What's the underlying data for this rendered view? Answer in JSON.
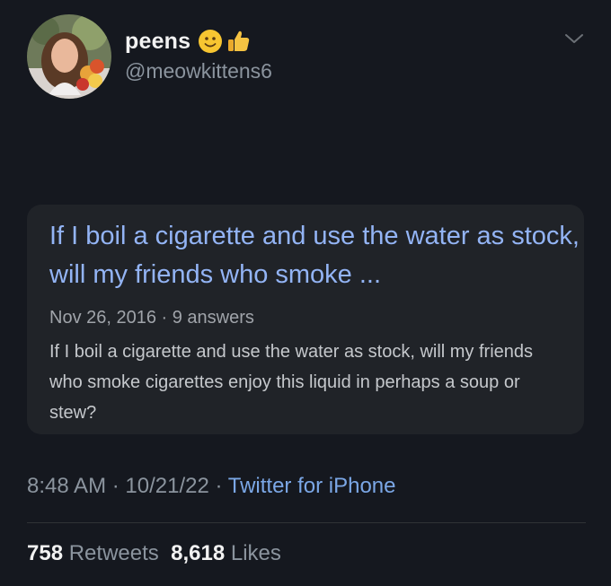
{
  "tweet": {
    "author": {
      "display_name": "peens",
      "handle": "@meowkittens6",
      "name_emojis": [
        "slightly-smiling-face",
        "thumbs-up"
      ]
    },
    "quoted_result": {
      "title": "If I boil a cigarette and use the water as stock, will my friends who smoke ...",
      "meta": "Nov 26, 2016 · 9 answers",
      "snippet": "If I boil a cigarette and use the water as stock, will my friends who smoke cigarettes enjoy this liquid in perhaps a soup or stew?"
    },
    "time": "8:48 AM",
    "date": "10/21/22",
    "separator": "·",
    "source": "Twitter for iPhone",
    "retweets_count": "758",
    "retweets_label": "Retweets",
    "likes_count": "8,618",
    "likes_label": "Likes"
  },
  "colors": {
    "background": "#15181f",
    "card_background": "#202328",
    "link_blue": "#93b4f5",
    "secondary_text": "#8b949e"
  }
}
